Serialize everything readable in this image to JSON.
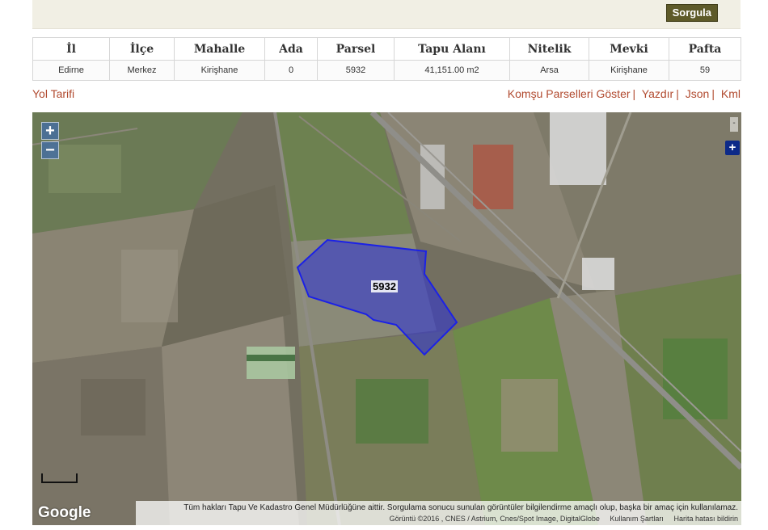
{
  "toolbar": {
    "query_button": "Sorgula"
  },
  "table": {
    "headers": [
      "İl",
      "İlçe",
      "Mahalle",
      "Ada",
      "Parsel",
      "Tapu Alanı",
      "Nitelik",
      "Mevki",
      "Pafta"
    ],
    "row": [
      "Edirne",
      "Merkez",
      "Kirişhane",
      "0",
      "5932",
      "41,151.00 m2",
      "Arsa",
      "Kirişhane",
      "59"
    ]
  },
  "links": {
    "directions": "Yol Tarifi",
    "neighbors": "Komşu Parselleri Göster",
    "print": "Yazdır",
    "json": "Json",
    "kml": "Kml",
    "separator": "|"
  },
  "map": {
    "zoom_in": "+",
    "zoom_out": "−",
    "layer_button": "+",
    "layer_toggle": "-",
    "parcel_label": "5932",
    "parcel_color": "#2a2fd8",
    "google_logo": "Google",
    "disclaimer": "Tüm hakları Tapu Ve Kadastro Genel Müdürlüğüne aittir. Sorgulama sonucu sunulan görüntüler bilgilendirme amaçlı olup, başka bir amaç için kullanılamaz.",
    "imagery_credit": "Görüntü ©2016 , CNES / Astrium, Cnes/Spot Image, DigitalGlobe",
    "terms": "Kullanım Şartları",
    "report_error": "Harita hatası bildirin"
  }
}
